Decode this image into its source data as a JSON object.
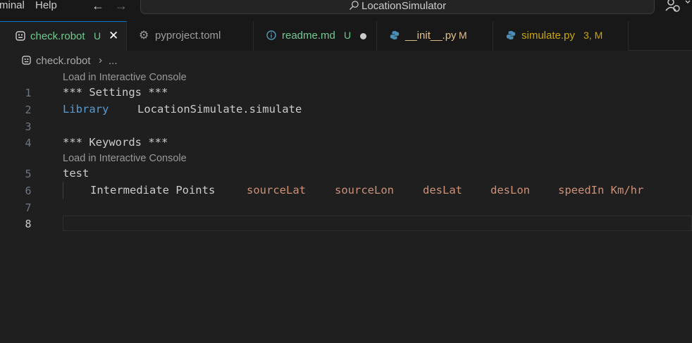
{
  "menu": {
    "items": [
      "minal",
      "Help"
    ]
  },
  "command_center": {
    "label": "LocationSimulator"
  },
  "tabs": [
    {
      "label": "check.robot",
      "badge": "U",
      "status": "close",
      "active": true,
      "color": "#73c991",
      "badge_color": "#73c991"
    },
    {
      "label": "pyproject.toml",
      "badge": "",
      "status": "",
      "active": false,
      "color": "#9d9d9d",
      "badge_color": ""
    },
    {
      "label": "readme.md",
      "badge": "U",
      "status": "dirty",
      "active": false,
      "color": "#73c991",
      "badge_color": "#73c991"
    },
    {
      "label": "__init__.py",
      "badge": "M",
      "status": "",
      "active": false,
      "color": "#e2c08d",
      "badge_color": "#e2c08d"
    },
    {
      "label": "simulate.py",
      "badge": "3, M",
      "status": "",
      "active": false,
      "color": "#cca700",
      "badge_color": "#cca700"
    }
  ],
  "breadcrumb": {
    "file": "check.robot",
    "separator": ">",
    "rest": "..."
  },
  "editor": {
    "codelens": [
      "Load in Interactive Console",
      "Load in Interactive Console"
    ],
    "line_numbers": [
      "1",
      "2",
      "3",
      "4",
      "5",
      "6",
      "7",
      "8"
    ],
    "lines": {
      "l1": "*** Settings ***",
      "l2_kw": "Library",
      "l2_val": "LocationSimulate.simulate",
      "l4": "*** Keywords ***",
      "l5": "test",
      "l6_kw": "Intermediate Points",
      "l6_args": [
        "sourceLat",
        "sourceLon",
        "desLat",
        "desLon",
        "speedIn Km/hr"
      ]
    }
  },
  "colors": {
    "accent": "#0078d4",
    "keyword": "#569cd6",
    "argument": "#ce9178"
  }
}
